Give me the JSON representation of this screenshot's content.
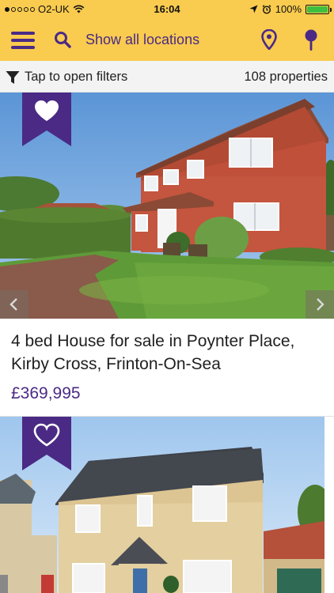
{
  "status_bar": {
    "carrier": "O2-UK",
    "time": "16:04",
    "battery": "100%",
    "battery_level": 1.0,
    "signal_bars_filled": 1,
    "signal_bars_total": 5
  },
  "header": {
    "title": "Show all locations",
    "icons": [
      "menu-icon",
      "search-icon",
      "map-pin-icon",
      "pushpin-icon"
    ]
  },
  "filters": {
    "label": "Tap to open filters",
    "count": "108 properties",
    "icon": "filter-icon"
  },
  "listings": [
    {
      "title": "4 bed House for sale in Poynter Place, Kirby Cross, Frinton-On-Sea",
      "price": "£369,995",
      "favourited": true
    },
    {
      "favourited": false
    }
  ],
  "colors": {
    "accent": "#f9cb4f",
    "brand": "#4a2a85",
    "battery": "#3fbf3f"
  }
}
